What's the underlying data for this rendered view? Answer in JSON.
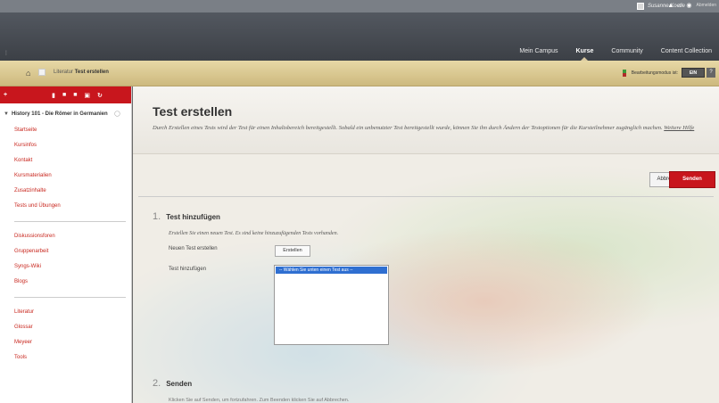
{
  "topbar": {
    "user_name": "Susanne Koelle",
    "power_label": "Abmelden"
  },
  "nav": {
    "tabs": [
      {
        "label": "Mein Campus",
        "active": false
      },
      {
        "label": "Kurse",
        "active": true
      },
      {
        "label": "Community",
        "active": false
      },
      {
        "label": "Content Collection",
        "active": false
      }
    ]
  },
  "breadcrumb": {
    "parent": "Literatur",
    "current": "Test erstellen",
    "edit_mode_label": "Bearbeitungsmodus ist:",
    "edit_mode_value": "EIN",
    "help": "?"
  },
  "sidebar": {
    "course_title": "History 101 - Die Römer in Germanien",
    "group1": [
      "Startseite",
      "Kursinfos",
      "Kontakt",
      "Kursmaterialien",
      "Zusatzinhalte",
      "Tests und Übungen"
    ],
    "group2": [
      "Diskussionsforen",
      "Gruppenarbeit",
      "Syngs-Wiki",
      "Blogs"
    ],
    "group3": [
      "Literatur",
      "Glossar",
      "Meyeer",
      "Tools"
    ]
  },
  "main": {
    "title": "Test erstellen",
    "description": "Durch Erstellen eines Tests wird der Test für einen Inhaltsbereich bereitgestellt. Sobald ein unbenutzter Test bereitgestellt wurde, können Sie ihn durch Ändern der Testoptionen für die Kursteilnehmer zugänglich machen.",
    "more_help": "Weitere Hilfe",
    "cancel_label": "Abbrechen",
    "submit_label": "Senden",
    "step1": {
      "num": "1.",
      "title": "Test hinzufügen",
      "hint": "Erstellen Sie einen neuen Test. Es sind keine hinzuzufügenden Tests vorhanden.",
      "new_test_label": "Neuen Test erstellen",
      "create_button": "Erstellen",
      "add_test_label": "Test hinzufügen",
      "select_option": "-- Wählen Sie unten einen Test aus --"
    },
    "step2": {
      "num": "2.",
      "title": "Senden",
      "desc": "Klicken Sie auf Senden, um fortzufahren. Zum Beenden klicken Sie auf Abbrechen."
    }
  },
  "colors": {
    "accent_red": "#c8161d",
    "breadcrumb_gold": "#d8c58f",
    "nav_dark": "#45494f",
    "select_blue": "#2f6fd1"
  }
}
